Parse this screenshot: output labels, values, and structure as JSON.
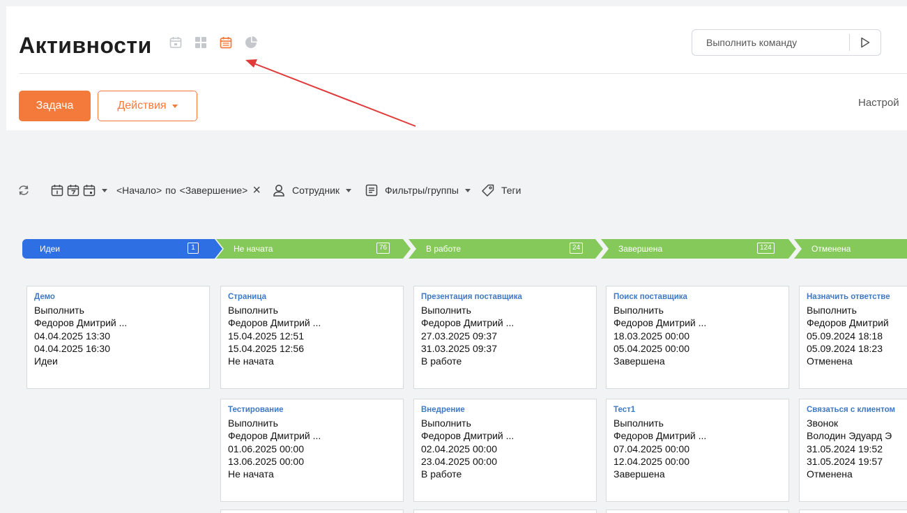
{
  "header": {
    "title": "Активности",
    "view_icons": [
      "calendar-icon",
      "grid-icon",
      "kanban-calendar-icon",
      "pie-chart-icon"
    ],
    "command": {
      "placeholder": "Выполнить команду"
    }
  },
  "toolbar": {
    "task_label": "Задача",
    "actions_label": "Действия",
    "settings_label": "Настрой"
  },
  "filters": {
    "start_label": "<Начало>",
    "by_label": "по",
    "end_label": "<Завершение>",
    "clear_symbol": "×",
    "employee_label": "Сотрудник",
    "filters_label": "Фильтры/группы",
    "tags_label": "Теги"
  },
  "stages": [
    {
      "label": "Идеи",
      "count": "1",
      "color": "#2f6fe4"
    },
    {
      "label": "Не начата",
      "count": "76",
      "color": "#86c95b"
    },
    {
      "label": "В работе",
      "count": "24",
      "color": "#86c95b"
    },
    {
      "label": "Завершена",
      "count": "124",
      "color": "#86c95b"
    },
    {
      "label": "Отменена",
      "count": "",
      "color": "#86c95b"
    }
  ],
  "columns": [
    {
      "cards": [
        {
          "title": "Демо",
          "type": "Выполнить",
          "owner": "Федоров Дмитрий ...",
          "start": "04.04.2025 13:30",
          "end": "04.04.2025 16:30",
          "status": "Идеи"
        }
      ]
    },
    {
      "cards": [
        {
          "title": "Страница",
          "type": "Выполнить",
          "owner": "Федоров Дмитрий ...",
          "start": "15.04.2025 12:51",
          "end": "15.04.2025 12:56",
          "status": "Не начата"
        },
        {
          "title": "Тестирование",
          "type": "Выполнить",
          "owner": "Федоров Дмитрий ...",
          "start": "01.06.2025 00:00",
          "end": "13.06.2025 00:00",
          "status": "Не начата"
        }
      ]
    },
    {
      "cards": [
        {
          "title": "Презентация поставщика",
          "type": "Выполнить",
          "owner": "Федоров Дмитрий ...",
          "start": "27.03.2025 09:37",
          "end": "31.03.2025 09:37",
          "status": "В работе"
        },
        {
          "title": "Внедрение",
          "type": "Выполнить",
          "owner": "Федоров Дмитрий ...",
          "start": "02.04.2025 00:00",
          "end": "23.04.2025 00:00",
          "status": "В работе"
        }
      ]
    },
    {
      "cards": [
        {
          "title": "Поиск поставщика",
          "type": "Выполнить",
          "owner": "Федоров Дмитрий ...",
          "start": "18.03.2025 00:00",
          "end": "05.04.2025 00:00",
          "status": "Завершена"
        },
        {
          "title": "Тест1",
          "type": "Выполнить",
          "owner": "Федоров Дмитрий ...",
          "start": "07.04.2025 00:00",
          "end": "12.04.2025 00:00",
          "status": "Завершена"
        }
      ]
    },
    {
      "cards": [
        {
          "title": "Назначить ответстве",
          "type": "Выполнить",
          "owner": "Федоров Дмитрий",
          "start": "05.09.2024 18:18",
          "end": "05.09.2024 18:23",
          "status": "Отменена"
        },
        {
          "title": "Связаться с клиентом",
          "type": "Звонок",
          "owner": "Володин Эдуард Э",
          "start": "31.05.2024 19:52",
          "end": "31.05.2024 19:57",
          "status": "Отменена"
        }
      ]
    }
  ],
  "colors": {
    "accent": "#f47a3b",
    "link": "#3f79c4",
    "stage_active": "#2f6fe4",
    "stage": "#86c95b",
    "annotation": "#e03a3a"
  }
}
